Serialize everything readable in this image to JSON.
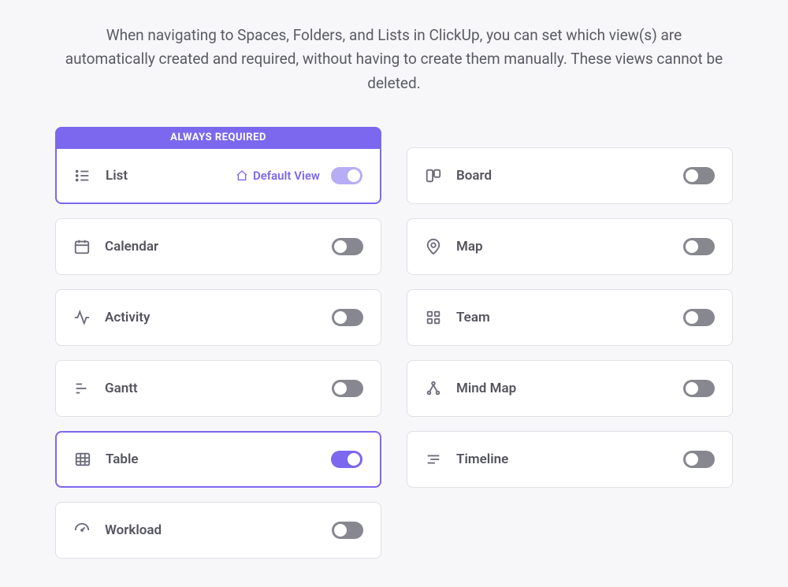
{
  "description": "When navigating to Spaces, Folders, and Lists in ClickUp, you can set which view(s) are automatically created and required, without having to create them manually. These views cannot be deleted.",
  "required_banner": "ALWAYS REQUIRED",
  "default_view_label": "Default View",
  "views": {
    "list": {
      "label": "List"
    },
    "board": {
      "label": "Board"
    },
    "calendar": {
      "label": "Calendar"
    },
    "map": {
      "label": "Map"
    },
    "activity": {
      "label": "Activity"
    },
    "team": {
      "label": "Team"
    },
    "gantt": {
      "label": "Gantt"
    },
    "mindmap": {
      "label": "Mind Map"
    },
    "table": {
      "label": "Table"
    },
    "timeline": {
      "label": "Timeline"
    },
    "workload": {
      "label": "Workload"
    }
  }
}
